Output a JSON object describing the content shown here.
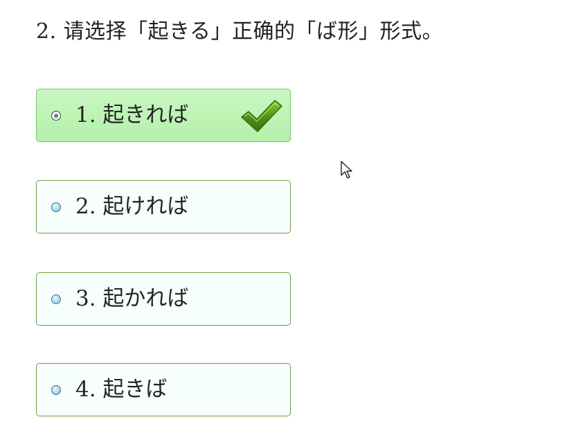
{
  "question": {
    "text": "2. 请选择「起きる」正确的「ば形」形式。"
  },
  "options": [
    {
      "label": "1. 起きれば",
      "selected": true,
      "correct": true
    },
    {
      "label": "2. 起ければ",
      "selected": false,
      "correct": false
    },
    {
      "label": "3. 起かれば",
      "selected": false,
      "correct": false
    },
    {
      "label": "4. 起きば",
      "selected": false,
      "correct": false
    }
  ],
  "colors": {
    "selected_background": "#b4f1ab",
    "option_background": "#f6fffd",
    "option_border": "#6d9a3e",
    "check_mark": "#4f8f16"
  },
  "icons": {
    "radio": "radio-button-icon",
    "correct": "check-mark-icon",
    "cursor": "mouse-cursor-icon"
  }
}
